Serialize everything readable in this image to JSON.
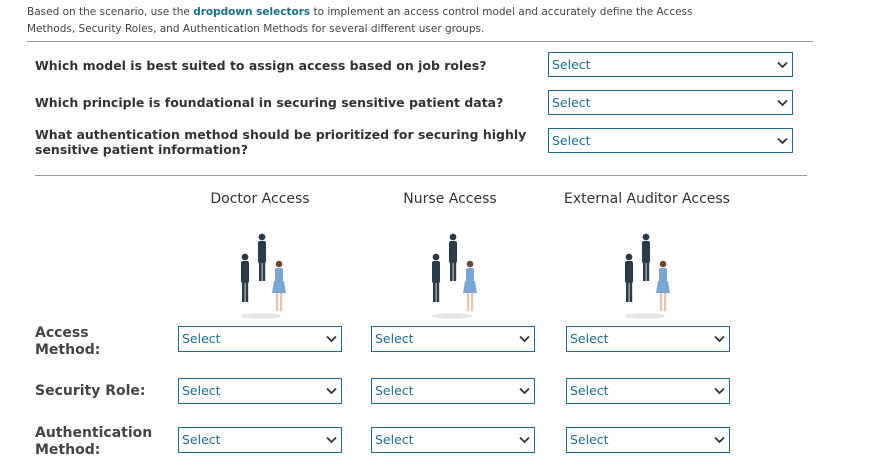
{
  "intro": {
    "before": "Based on the scenario, use the ",
    "emphasis": "dropdown selectors",
    "after": " to implement an access control model and accurately define the Access Methods, Security Roles, and Authentication Methods for several different user groups."
  },
  "questions": [
    {
      "text": "Which model is best suited to assign access based on job roles?",
      "selected": "Select"
    },
    {
      "text": "Which principle is foundational in securing sensitive patient data?",
      "selected": "Select"
    },
    {
      "text": "What authentication method should be prioritized for securing highly sensitive patient information?",
      "selected": "Select"
    }
  ],
  "groups": [
    {
      "title": "Doctor Access",
      "icon": "user-group-illustration"
    },
    {
      "title": "Nurse Access",
      "icon": "user-group-illustration"
    },
    {
      "title": "External Auditor Access",
      "icon": "user-group-illustration"
    }
  ],
  "rows": [
    {
      "label": "Access Method:",
      "values": [
        "Select",
        "Select",
        "Select"
      ]
    },
    {
      "label": "Security Role:",
      "values": [
        "Select",
        "Select",
        "Select"
      ]
    },
    {
      "label": "Authentication Method:",
      "values": [
        "Select",
        "Select",
        "Select"
      ]
    }
  ],
  "colors": {
    "accent": "#1a6e8a",
    "text": "#333333",
    "rule": "#9a9a9a"
  }
}
